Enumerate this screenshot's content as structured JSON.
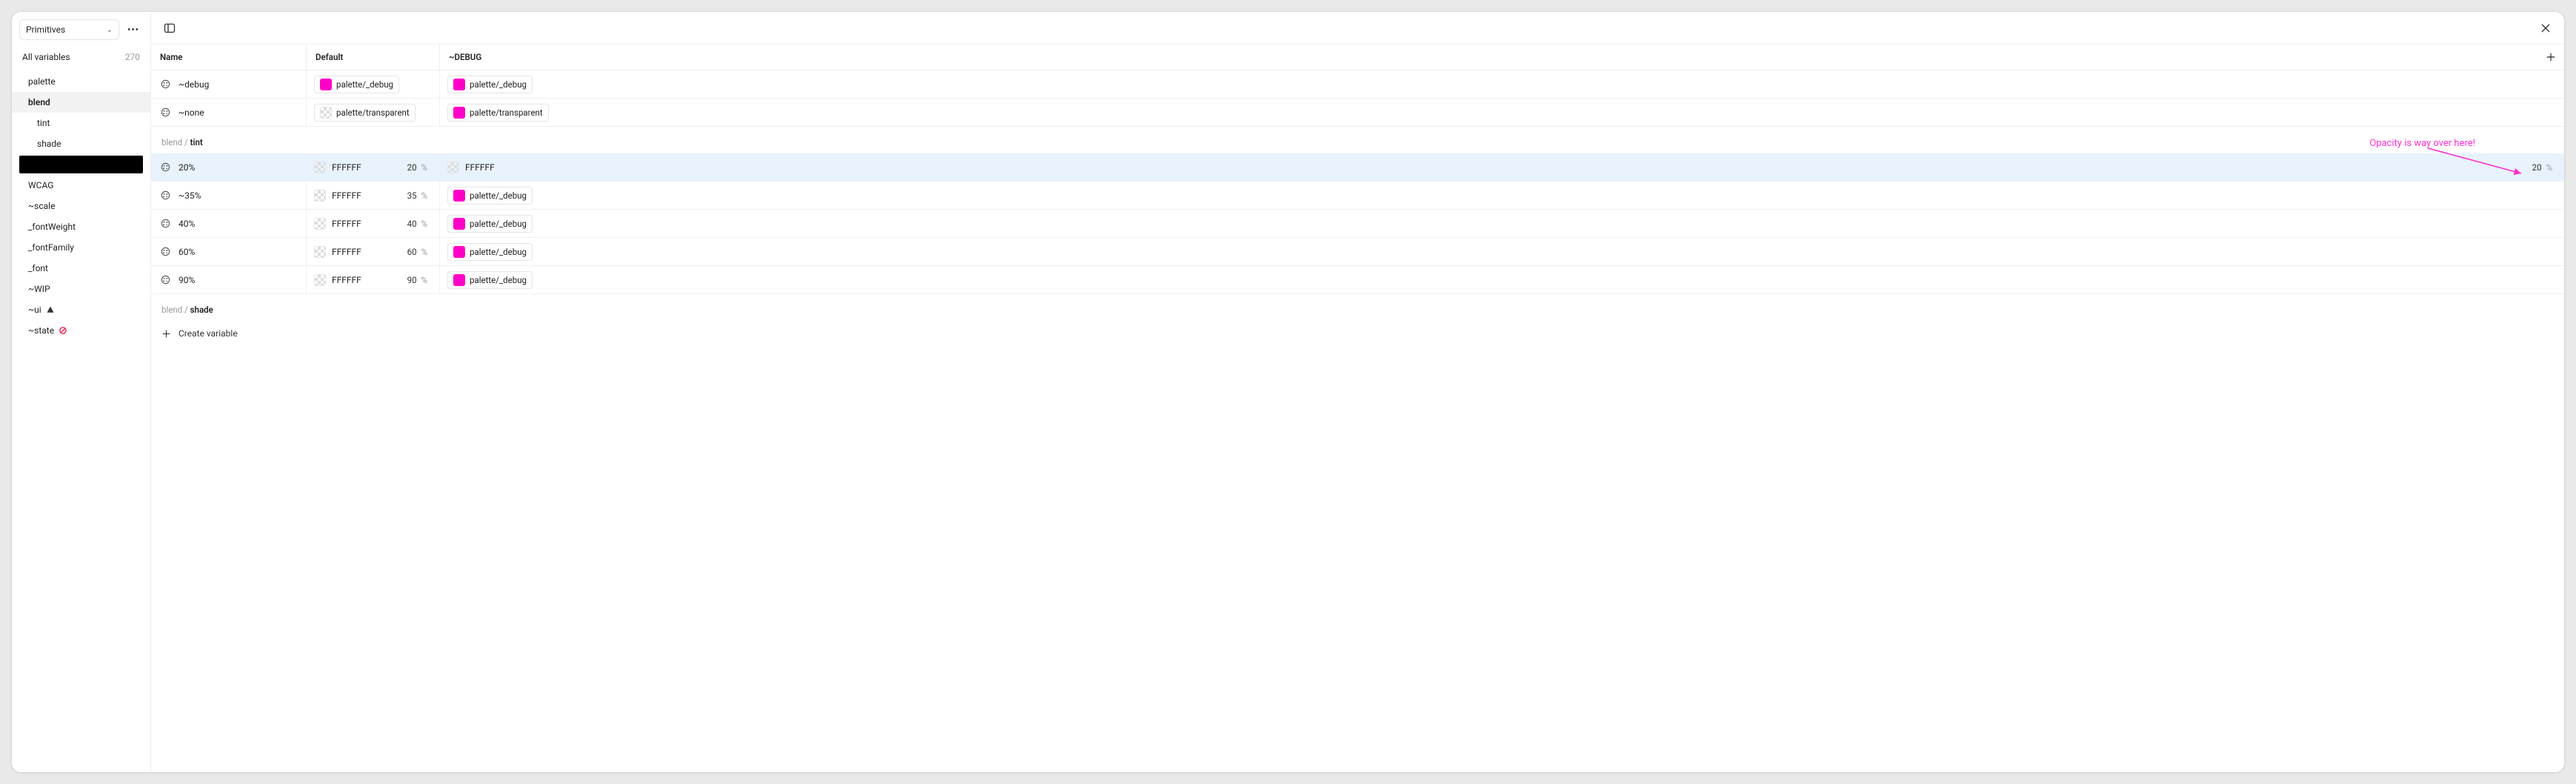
{
  "sidebar": {
    "collection": "Primitives",
    "all_variables_label": "All variables",
    "all_variables_count": "270",
    "groups": [
      {
        "label": "palette",
        "kind": "plain"
      },
      {
        "label": "blend",
        "kind": "selected"
      },
      {
        "label": "tint",
        "kind": "child"
      },
      {
        "label": "shade",
        "kind": "child"
      },
      {
        "label": "",
        "kind": "black"
      },
      {
        "label": "WCAG",
        "kind": "plain"
      },
      {
        "label": "~scale",
        "kind": "plain"
      },
      {
        "label": "_fontWeight",
        "kind": "plain"
      },
      {
        "label": "_fontFamily",
        "kind": "plain"
      },
      {
        "label": "_font",
        "kind": "plain"
      },
      {
        "label": "~WIP",
        "kind": "plain"
      },
      {
        "label": "~ui",
        "kind": "warn"
      },
      {
        "label": "~state",
        "kind": "stop"
      }
    ]
  },
  "header": {
    "col_name": "Name",
    "col_default": "Default",
    "col_debug": "~DEBUG"
  },
  "top_rows": [
    {
      "name": "~debug",
      "default": {
        "type": "alias",
        "swatch": "magenta",
        "label": "palette/_debug"
      },
      "debug": {
        "type": "alias",
        "swatch": "magenta",
        "label": "palette/_debug"
      }
    },
    {
      "name": "~none",
      "default": {
        "type": "alias",
        "swatch": "checker",
        "label": "palette/transparent"
      },
      "debug": {
        "type": "alias",
        "swatch": "magenta",
        "label": "palette/transparent"
      }
    }
  ],
  "tint_section": {
    "path_prefix": "blend / ",
    "path_strong": "tint",
    "rows": [
      {
        "name": "20%",
        "highlight": true,
        "default": {
          "type": "hex",
          "swatch": "checker",
          "hex": "FFFFFF",
          "opacity": "20"
        },
        "debug": {
          "type": "hex",
          "swatch": "checker",
          "hex": "FFFFFF",
          "opacity": "20"
        }
      },
      {
        "name": "~35%",
        "default": {
          "type": "hex",
          "swatch": "checker",
          "hex": "FFFFFF",
          "opacity": "35"
        },
        "debug": {
          "type": "alias",
          "swatch": "magenta",
          "label": "palette/_debug"
        }
      },
      {
        "name": "40%",
        "default": {
          "type": "hex",
          "swatch": "checker",
          "hex": "FFFFFF",
          "opacity": "40"
        },
        "debug": {
          "type": "alias",
          "swatch": "magenta",
          "label": "palette/_debug"
        }
      },
      {
        "name": "60%",
        "default": {
          "type": "hex",
          "swatch": "checker",
          "hex": "FFFFFF",
          "opacity": "60"
        },
        "debug": {
          "type": "alias",
          "swatch": "magenta",
          "label": "palette/_debug"
        }
      },
      {
        "name": "90%",
        "default": {
          "type": "hex",
          "swatch": "checker",
          "hex": "FFFFFF",
          "opacity": "90"
        },
        "debug": {
          "type": "alias",
          "swatch": "magenta",
          "label": "palette/_debug"
        }
      }
    ]
  },
  "shade_section": {
    "path_prefix": "blend / ",
    "path_strong": "shade"
  },
  "create_label": "Create variable",
  "pct_symbol": "%",
  "annotation": {
    "text": "Opacity is way over here!"
  }
}
